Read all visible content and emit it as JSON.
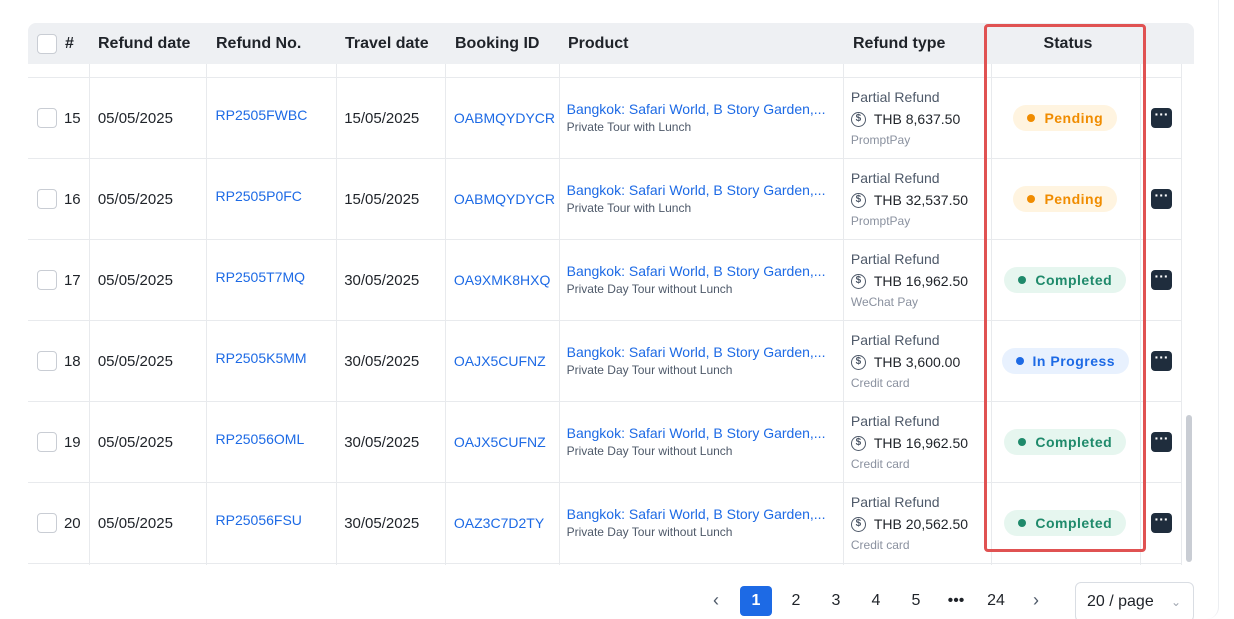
{
  "table": {
    "headers": {
      "index": "#",
      "refund_date": "Refund date",
      "refund_no": "Refund No.",
      "travel_date": "Travel date",
      "booking_id": "Booking ID",
      "product": "Product",
      "refund_type": "Refund type",
      "status": "Status"
    },
    "rows": [
      {
        "index": "15",
        "refund_date": "05/05/2025",
        "refund_no": "RP2505FWBC",
        "travel_date": "15/05/2025",
        "booking_id": "OABMQYDYCR",
        "product_name": "Bangkok: Safari World, B Story Garden,...",
        "product_sub": "Private Tour with Lunch",
        "refund_type": "Partial Refund",
        "amount": "THB 8,637.50",
        "payment": "PromptPay",
        "status": "Pending",
        "status_color": "#f08c00",
        "status_bg": "#fff4e0"
      },
      {
        "index": "16",
        "refund_date": "05/05/2025",
        "refund_no": "RP2505P0FC",
        "travel_date": "15/05/2025",
        "booking_id": "OABMQYDYCR",
        "product_name": "Bangkok: Safari World, B Story Garden,...",
        "product_sub": "Private Tour with Lunch",
        "refund_type": "Partial Refund",
        "amount": "THB 32,537.50",
        "payment": "PromptPay",
        "status": "Pending",
        "status_color": "#f08c00",
        "status_bg": "#fff4e0"
      },
      {
        "index": "17",
        "refund_date": "05/05/2025",
        "refund_no": "RP2505T7MQ",
        "travel_date": "30/05/2025",
        "booking_id": "OA9XMK8HXQ",
        "product_name": "Bangkok: Safari World, B Story Garden,...",
        "product_sub": "Private Day Tour without Lunch",
        "refund_type": "Partial Refund",
        "amount": "THB 16,962.50",
        "payment": "WeChat Pay",
        "status": "Completed",
        "status_color": "#1f8a6b",
        "status_bg": "#e6f6ef"
      },
      {
        "index": "18",
        "refund_date": "05/05/2025",
        "refund_no": "RP2505K5MM",
        "travel_date": "30/05/2025",
        "booking_id": "OAJX5CUFNZ",
        "product_name": "Bangkok: Safari World, B Story Garden,...",
        "product_sub": "Private Day Tour without Lunch",
        "refund_type": "Partial Refund",
        "amount": "THB 3,600.00",
        "payment": "Credit card",
        "status": "In Progress",
        "status_color": "#1d6ae5",
        "status_bg": "#e8f1fe"
      },
      {
        "index": "19",
        "refund_date": "05/05/2025",
        "refund_no": "RP25056OML",
        "travel_date": "30/05/2025",
        "booking_id": "OAJX5CUFNZ",
        "product_name": "Bangkok: Safari World, B Story Garden,...",
        "product_sub": "Private Day Tour without Lunch",
        "refund_type": "Partial Refund",
        "amount": "THB 16,962.50",
        "payment": "Credit card",
        "status": "Completed",
        "status_color": "#1f8a6b",
        "status_bg": "#e6f6ef"
      },
      {
        "index": "20",
        "refund_date": "05/05/2025",
        "refund_no": "RP25056FSU",
        "travel_date": "30/05/2025",
        "booking_id": "OAZ3C7D2TY",
        "product_name": "Bangkok: Safari World, B Story Garden,...",
        "product_sub": "Private Day Tour without Lunch",
        "refund_type": "Partial Refund",
        "amount": "THB 20,562.50",
        "payment": "Credit card",
        "status": "Completed",
        "status_color": "#1f8a6b",
        "status_bg": "#e6f6ef"
      }
    ]
  },
  "icons": {
    "currency": "dollar-circle-icon",
    "more": "more-dots-icon"
  },
  "pagination": {
    "prev": "‹",
    "pages": [
      "1",
      "2",
      "3",
      "4",
      "5"
    ],
    "ellipsis": "•••",
    "last": "24",
    "next": "›",
    "current": "1",
    "page_size": "20 / page"
  },
  "highlight_color": "#e05252"
}
